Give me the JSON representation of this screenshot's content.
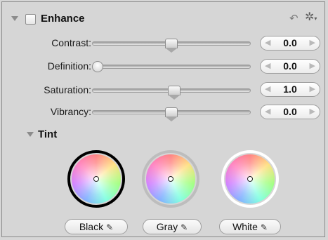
{
  "header": {
    "title": "Enhance",
    "undo_icon": "undo-arrow-icon",
    "gear_icon": "gear-menu-icon"
  },
  "adjustments": [
    {
      "label": "Contrast:",
      "value": "0.0",
      "slider_fraction": 0.5
    },
    {
      "label": "Definition:",
      "value": "0.0",
      "slider_fraction": 0.0
    },
    {
      "label": "Saturation:",
      "value": "1.0",
      "slider_fraction": 0.5
    },
    {
      "label": "Vibrancy:",
      "value": "0.0",
      "slider_fraction": 0.5
    }
  ],
  "tint": {
    "label": "Tint",
    "wheels": [
      {
        "button": "Black",
        "ring_color": "#000000"
      },
      {
        "button": "Gray",
        "ring_color": "#bdbdbd"
      },
      {
        "button": "White",
        "ring_color": "#ffffff"
      }
    ],
    "dropper_icon": "eyedropper-icon"
  }
}
